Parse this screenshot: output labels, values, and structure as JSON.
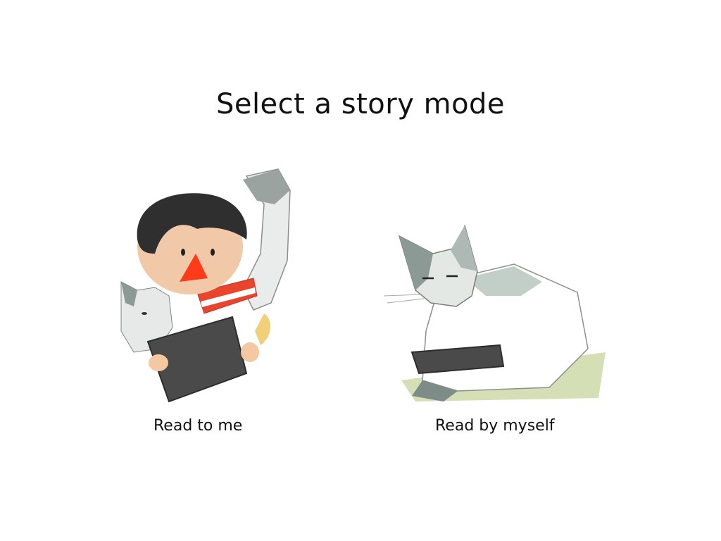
{
  "page": {
    "title": "Select a story mode"
  },
  "modes": [
    {
      "label": "Read to me",
      "illustration": "boy-cat-tablet-illustration"
    },
    {
      "label": "Read by myself",
      "illustration": "cat-tablet-illustration"
    }
  ],
  "colors": {
    "background": "#ffffff",
    "text": "#111111",
    "boy_hair": "#2f2f2f",
    "boy_nose": "#ff3b1a",
    "scarf_red": "#e8452c",
    "tablet": "#4a4a4a",
    "cat_gray": "#8c9a96",
    "grass_green": "#b9c98f"
  }
}
